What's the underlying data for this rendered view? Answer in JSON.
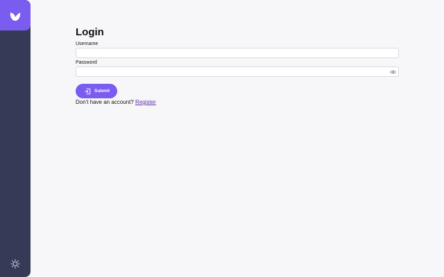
{
  "sidebar": {
    "logo_icon": "logo-mark-icon",
    "theme_toggle_icon": "sun-icon"
  },
  "login": {
    "title": "Login",
    "username_label": "Username",
    "username_value": "",
    "password_label": "Password",
    "password_value": "",
    "show_password_icon": "eye-icon",
    "submit_label": "Submit",
    "submit_icon": "login-icon",
    "no_account_text": "Don't have an account?",
    "register_link": "Register"
  },
  "colors": {
    "accent": "#7b5cf0",
    "sidebar_bg": "#353a56",
    "page_bg": "#f7f7f9",
    "link": "#5b2ea6"
  }
}
